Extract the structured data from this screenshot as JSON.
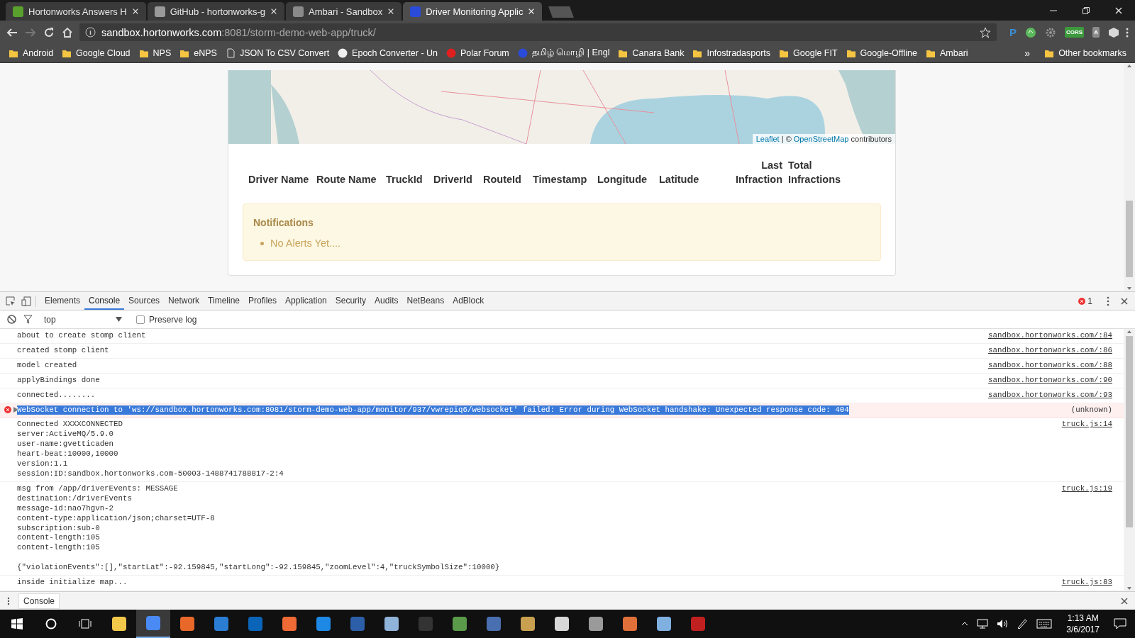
{
  "browser": {
    "tabs": [
      {
        "title": "Hortonworks Answers H",
        "color": "#5aa02c",
        "selected": false
      },
      {
        "title": "GitHub - hortonworks-g",
        "color": "#9a9a9a",
        "selected": false
      },
      {
        "title": "Ambari - Sandbox",
        "color": "#8a8a8a",
        "selected": false
      },
      {
        "title": "Driver Monitoring Applic",
        "color": "#2a4bd7",
        "selected": true
      }
    ],
    "address": {
      "host": "sandbox.hortonworks.com",
      "path": ":8081/storm-demo-web-app/truck/"
    },
    "extensions": [
      {
        "kind": "letter",
        "label": "P",
        "color": "#3b8ed8"
      },
      {
        "kind": "circle",
        "color": "#5cb85c"
      },
      {
        "kind": "gear",
        "color": "#9a9a9a"
      },
      {
        "kind": "tag",
        "label": "CORS",
        "color": "#3c9a3c"
      },
      {
        "kind": "tag",
        "label": "A",
        "color": "#8c8c8c"
      },
      {
        "kind": "cube",
        "color": "#d8d8d8"
      }
    ],
    "bookmarks": [
      {
        "label": "Android",
        "kind": "folder"
      },
      {
        "label": "Google Cloud",
        "kind": "folder"
      },
      {
        "label": "NPS",
        "kind": "folder"
      },
      {
        "label": "eNPS",
        "kind": "folder"
      },
      {
        "label": "JSON To CSV Convert",
        "kind": "page"
      },
      {
        "label": "Epoch Converter - Un",
        "kind": "site",
        "color": "#f0f0f0"
      },
      {
        "label": "Polar Forum",
        "kind": "site",
        "color": "#e02020"
      },
      {
        "label": "தமிழ் மொழி | Engl",
        "kind": "site",
        "color": "#2a4bd7"
      },
      {
        "label": "Canara Bank",
        "kind": "folder"
      },
      {
        "label": "Infostradasports",
        "kind": "folder"
      },
      {
        "label": "Google FIT",
        "kind": "folder"
      },
      {
        "label": "Google-Offline",
        "kind": "folder"
      },
      {
        "label": "Ambari",
        "kind": "folder"
      }
    ],
    "bookmarks_overflow": "»",
    "other_bookmarks": "Other bookmarks"
  },
  "page": {
    "map_attribution": {
      "link_1": "Leaflet",
      "separator": " | © ",
      "link_2": "OpenStreetMap",
      "suffix": " contributors"
    },
    "table": {
      "columns": [
        "Driver Name",
        "Route Name",
        "TruckId",
        "DriverId",
        "RouteId",
        "Timestamp",
        "Longitude",
        "Latitude",
        "Last Infraction",
        "Total Infractions"
      ]
    },
    "notifications": {
      "title": "Notifications",
      "items": [
        "No Alerts Yet...."
      ]
    }
  },
  "devtools": {
    "tabs": [
      {
        "label": "Elements",
        "selected": false
      },
      {
        "label": "Console",
        "selected": true
      },
      {
        "label": "Sources",
        "selected": false
      },
      {
        "label": "Network",
        "selected": false
      },
      {
        "label": "Timeline",
        "selected": false
      },
      {
        "label": "Profiles",
        "selected": false
      },
      {
        "label": "Application",
        "selected": false
      },
      {
        "label": "Security",
        "selected": false
      },
      {
        "label": "Audits",
        "selected": false
      },
      {
        "label": "NetBeans",
        "selected": false
      },
      {
        "label": "AdBlock",
        "selected": false
      }
    ],
    "error_count": "1",
    "context": "top",
    "preserve_log": {
      "label": "Preserve log",
      "checked": false
    },
    "messages": [
      {
        "kind": "log",
        "text": "about to create stomp client",
        "source": "sandbox.hortonworks.com/:84",
        "highlighted": false
      },
      {
        "kind": "log",
        "text": "created stomp client",
        "source": "sandbox.hortonworks.com/:86",
        "highlighted": false
      },
      {
        "kind": "log",
        "text": "model created",
        "source": "sandbox.hortonworks.com/:88",
        "highlighted": false
      },
      {
        "kind": "log",
        "text": "applyBindings done",
        "source": "sandbox.hortonworks.com/:90",
        "highlighted": false
      },
      {
        "kind": "log",
        "text": "connected........",
        "source": "sandbox.hortonworks.com/:93",
        "highlighted": false
      },
      {
        "kind": "error",
        "text": "WebSocket connection to 'ws://sandbox.hortonworks.com:8081/storm-demo-web-app/monitor/937/vwrepiq6/websocket' failed: Error during WebSocket handshake: Unexpected response code: 404",
        "source": "(unknown)",
        "highlighted": true
      },
      {
        "kind": "log",
        "text": "Connected XXXXCONNECTED\nserver:ActiveMQ/5.9.0\nuser-name:gvetticaden\nheart-beat:10000,10000\nversion:1.1\nsession:ID:sandbox.hortonworks.com-50003-1488741788817-2:4\n",
        "source": "truck.js:14",
        "highlighted": false
      },
      {
        "kind": "log",
        "text": "msg from /app/driverEvents: MESSAGE\ndestination:/driverEvents\nmessage-id:nao7hgvn-2\ncontent-type:application/json;charset=UTF-8\nsubscription:sub-0\ncontent-length:105\ncontent-length:105\n\n{\"violationEvents\":[],\"startLat\":-92.159845,\"startLong\":-92.159845,\"zoomLevel\":4,\"truckSymbolSize\":10000}",
        "source": "truck.js:19",
        "highlighted": false
      },
      {
        "kind": "log",
        "text": "inside initialize map...",
        "source": "truck.js:83",
        "highlighted": false
      }
    ],
    "drawer_tab": "Console"
  },
  "taskbar": {
    "apps": [
      {
        "color": "#f2c84b",
        "selected": false
      },
      {
        "color": "#4a8af4",
        "selected": true
      },
      {
        "color": "#e8682a",
        "selected": false
      },
      {
        "color": "#2b7cd3",
        "selected": false
      },
      {
        "color": "#0a64b8",
        "selected": false
      },
      {
        "color": "#f06a35",
        "selected": false
      },
      {
        "color": "#1e88e5",
        "selected": false
      },
      {
        "color": "#2d5fa8",
        "selected": false
      },
      {
        "color": "#8fb3d9",
        "selected": false
      },
      {
        "color": "#333333",
        "selected": false
      },
      {
        "color": "#5a9a4a",
        "selected": false
      },
      {
        "color": "#4a6fb0",
        "selected": false
      },
      {
        "color": "#c8a050",
        "selected": false
      },
      {
        "color": "#d8d8d8",
        "selected": false
      },
      {
        "color": "#9a9a9a",
        "selected": false
      },
      {
        "color": "#e0703a",
        "selected": false
      },
      {
        "color": "#7fb0e0",
        "selected": false
      },
      {
        "color": "#c02020",
        "selected": false
      }
    ],
    "time": "1:13 AM",
    "date": "3/6/2017"
  }
}
